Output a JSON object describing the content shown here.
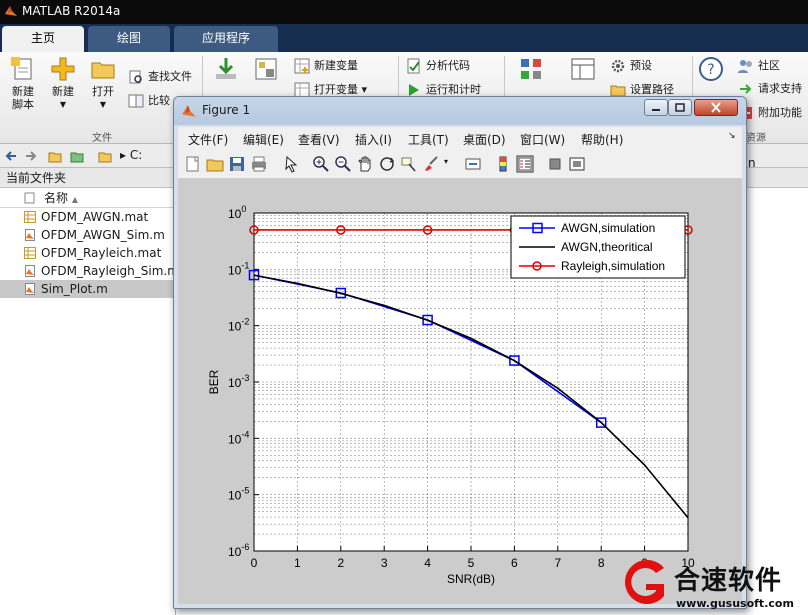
{
  "app": {
    "title": "MATLAB R2014a"
  },
  "tabs": [
    {
      "label": "主页"
    },
    {
      "label": "绘图"
    },
    {
      "label": "应用程序"
    }
  ],
  "ribbon": {
    "new_script": "新建\n脚本",
    "new": "新建",
    "open": "打开",
    "find_files": "查找文件",
    "compare": "比较",
    "import": "导入",
    "save_workspace": "保存",
    "new_variable": "新建变量",
    "open_variable": "打开变量",
    "analyze_code": "分析代码",
    "run_and_time": "运行和计时",
    "layout": "布局",
    "preferences": "预设",
    "set_path": "设置路径",
    "help": "帮助",
    "community": "社区",
    "request_support": "请求支持",
    "add_ons": "附加功能",
    "group_file": "文件",
    "group_resources": "资源"
  },
  "address": {
    "drive": "C:"
  },
  "file_browser": {
    "title": "当前文件夹",
    "column_name": "名称",
    "files": [
      {
        "name": "OFDM_AWGN.mat",
        "type": "mat"
      },
      {
        "name": "OFDM_AWGN_Sim.m",
        "type": "m"
      },
      {
        "name": "OFDM_Rayleich.mat",
        "type": "mat"
      },
      {
        "name": "OFDM_Rayleigh_Sim.m",
        "type": "m"
      },
      {
        "name": "Sim_Plot.m",
        "type": "m",
        "selected": true
      }
    ]
  },
  "right_panel": {
    "partial_text": "n"
  },
  "figure": {
    "title": "Figure 1",
    "menu": [
      "文件(F)",
      "编辑(E)",
      "查看(V)",
      "插入(I)",
      "工具(T)",
      "桌面(D)",
      "窗口(W)",
      "帮助(H)"
    ]
  },
  "chart_data": {
    "type": "line",
    "title": "",
    "xlabel": "SNR(dB)",
    "ylabel": "BER",
    "xlim": [
      0,
      10
    ],
    "ylim": [
      1e-06,
      1
    ],
    "yscale": "log",
    "grid": true,
    "legend_position": "top-right",
    "x_ticks": [
      0,
      1,
      2,
      3,
      4,
      5,
      6,
      7,
      8,
      9,
      10
    ],
    "y_ticks": [
      "10^0",
      "10^-1",
      "10^-2",
      "10^-3",
      "10^-4",
      "10^-5",
      "10^-6"
    ],
    "series": [
      {
        "name": "AWGN,simulation",
        "color": "#0000ff",
        "marker": "square",
        "line": true,
        "x": [
          0,
          2,
          4,
          6,
          8
        ],
        "y": [
          0.079,
          0.038,
          0.0126,
          0.0024,
          0.00019
        ]
      },
      {
        "name": "AWGN,theoritical",
        "color": "#000000",
        "marker": "none",
        "line": true,
        "x": [
          0,
          1,
          2,
          3,
          4,
          5,
          6,
          7,
          8,
          9,
          10
        ],
        "y": [
          0.0786,
          0.0563,
          0.0375,
          0.0229,
          0.0125,
          0.00595,
          0.00239,
          0.000773,
          0.000191,
          3.36e-05,
          3.9e-06
        ]
      },
      {
        "name": "Rayleigh,simulation",
        "color": "#dd0000",
        "marker": "circle",
        "line": true,
        "x": [
          0,
          2,
          4,
          6,
          8,
          10
        ],
        "y": [
          0.5,
          0.5,
          0.5,
          0.5,
          0.5,
          0.5
        ]
      }
    ]
  },
  "watermark": {
    "brand": "合速软件",
    "url": "www.gususoft.com"
  },
  "colors": {
    "tab_bar": "#162d4f",
    "title_bar": "#0b0b0b",
    "figure_frame": "#d6dfea",
    "axes_bg": "#ffffff"
  }
}
